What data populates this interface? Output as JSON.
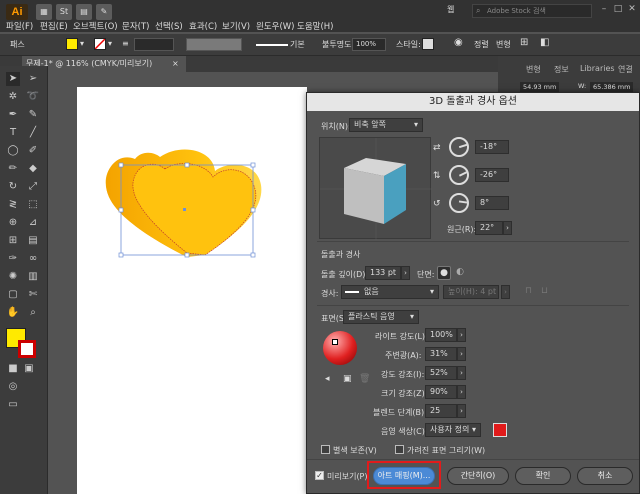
{
  "app": {
    "logo": "Ai",
    "icons": [
      "St"
    ],
    "workspace": "웹",
    "search_placeholder": "Adobe Stock 검색"
  },
  "menu": [
    "파일(F)",
    "편집(E)",
    "오브젝트(O)",
    "문자(T)",
    "선택(S)",
    "효과(C)",
    "보기(V)",
    "윈도우(W)",
    "도움말(H)"
  ],
  "controlbar": {
    "selection_label": "패스",
    "stroke_style": "기본",
    "opacity_label": "불투명도:",
    "opacity_value": "100%",
    "style_label": "스타일:",
    "align_label": "정렬",
    "transform_label": "변형"
  },
  "document_tab": {
    "title": "무제-1* @ 116% (CMYK/미리보기)",
    "close": "×"
  },
  "right_panel": {
    "tabs": [
      "변형",
      "정보",
      "Libraries",
      "연결"
    ],
    "x_value": "54.93 mm",
    "w_label": "W:",
    "w_value": "65.386 mm"
  },
  "colors": {
    "fill": "#ffea00",
    "stroke": "#ff0000",
    "heart": "#ffc20e",
    "cube_face": "#4aa0bf",
    "highlight_button": "#4b8ad6",
    "focus_ring": "#e21b1b"
  },
  "dialog": {
    "title": "3D 돌출과 경사 옵션",
    "position_label": "위치(N):",
    "position_value": "비축 앞쪽",
    "rot_x": "-18°",
    "rot_y": "-26°",
    "rot_z": "8°",
    "perspective_label": "원근(R):",
    "perspective_value": "22°",
    "extrude_section": "돌출과 경사",
    "extrude_depth_label": "돌출 깊이(D):",
    "extrude_depth_value": "133 pt",
    "cap_label": "단면:",
    "bevel_label": "경사:",
    "bevel_value": "없음",
    "height_label": "높이(H):",
    "height_value": "4 pt",
    "surface_label": "표면(S):",
    "surface_value": "플라스틱 음영",
    "light_intensity_label": "라이트 강도(L):",
    "light_intensity_value": "100%",
    "ambient_label": "주변광(A):",
    "ambient_value": "31%",
    "highlight_intensity_label": "강도 강조(I):",
    "highlight_intensity_value": "52%",
    "highlight_size_label": "크기 강조(Z):",
    "highlight_size_value": "90%",
    "blend_steps_label": "블렌드 단계(B):",
    "blend_steps_value": "25",
    "shading_color_label": "음영 색상(C):",
    "shading_color_value": "사용자 정의",
    "preserve_spot_label": "별색 보존(V)",
    "draw_hidden_label": "가려진 표면 그리기(W)",
    "preview_label": "미리보기(P)",
    "btn_map_art": "아트 매핑(M)...",
    "btn_fewer": "간단히(O)",
    "btn_ok": "확인",
    "btn_cancel": "취소"
  }
}
